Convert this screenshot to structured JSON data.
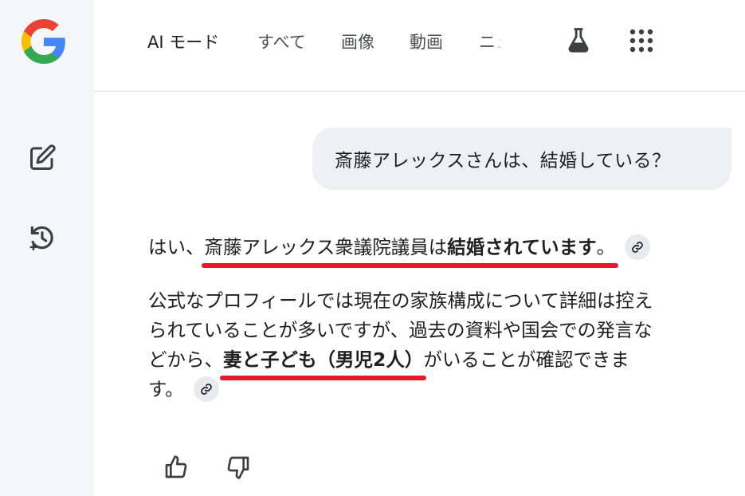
{
  "nav": {
    "tabs": [
      "AI モード",
      "すべて",
      "画像",
      "動画",
      "ニュ"
    ],
    "active_tab": "AI モード"
  },
  "sidebar": {
    "items": [
      {
        "icon": "google-logo"
      },
      {
        "icon": "new-chat-icon"
      },
      {
        "icon": "history-icon"
      }
    ]
  },
  "query": {
    "text": "斎藤アレックスさんは、結婚している？"
  },
  "answer": {
    "l1a": "はい、",
    "l1b": "斎藤アレックス衆議院議員は",
    "l1c": "結婚されています",
    "l1d": "。",
    "l2": "公式なプロフィールでは現在の家族構成について詳細は控え",
    "l3": "られていることが多いですが、過去の資料や国会での発言な",
    "l4a": "どから、",
    "l4b": "妻と子ども（男児2人）",
    "l4c": "がいることが確認できま",
    "l5": "す。"
  },
  "colors": {
    "underline": "#e8192c",
    "sidebar_bg": "#f5f6f8",
    "bubble_bg": "#eef0f3"
  }
}
